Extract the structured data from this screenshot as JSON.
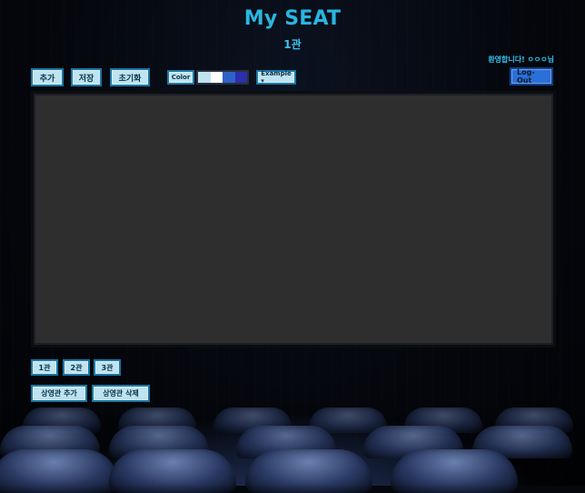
{
  "header": {
    "title": "My SEAT",
    "hall_title": "1관",
    "welcome": "환영합니다! ㅇㅇㅇ님"
  },
  "toolbar": {
    "add_label": "추가",
    "save_label": "저장",
    "reset_label": "초기화",
    "color_label": "Color",
    "example_label": "Example ▾",
    "logout_label": "Log-Out"
  },
  "colors": {
    "swatches": [
      "#bfe3f0",
      "#ffffff",
      "#2d62c9",
      "#2b2fae"
    ]
  },
  "halls": {
    "tabs": [
      "1관",
      "2관",
      "3관"
    ]
  },
  "hall_actions": {
    "add_hall_label": "상영관 추가",
    "delete_hall_label": "상영관 삭제"
  }
}
